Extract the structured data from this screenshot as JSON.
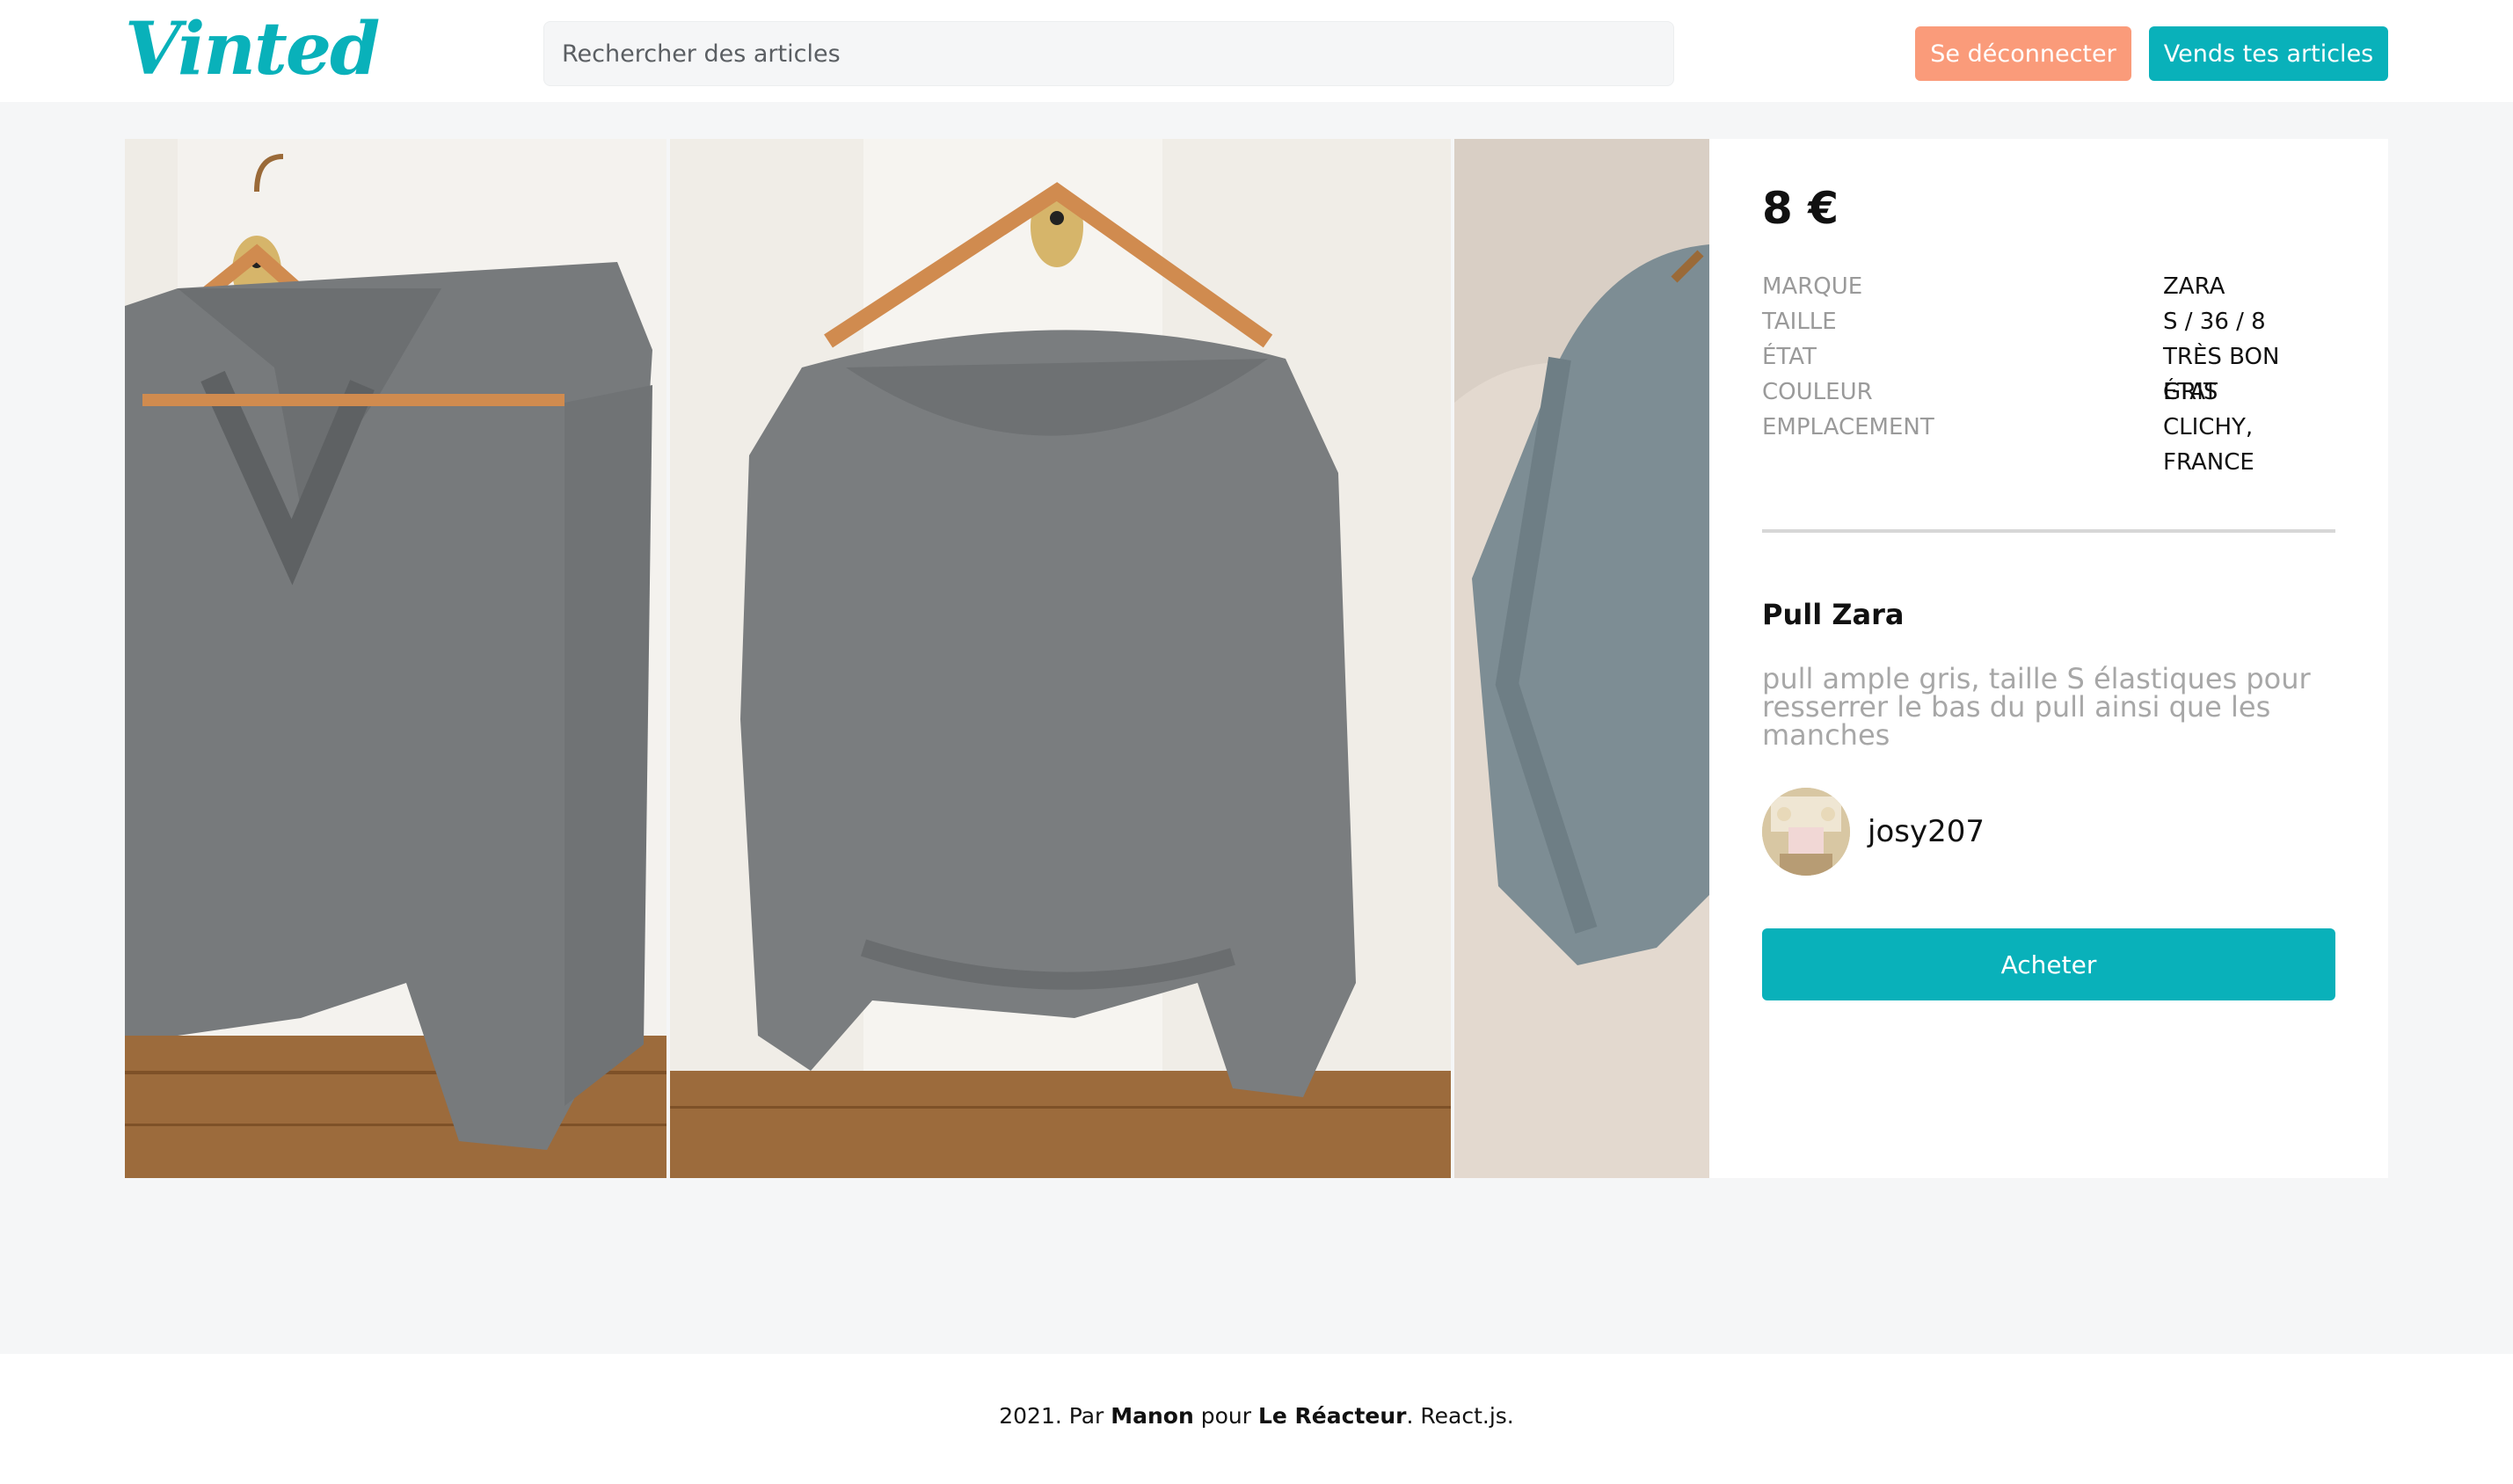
{
  "header": {
    "logo": "Vinted",
    "search_placeholder": "Rechercher des articles",
    "logout_label": "Se déconnecter",
    "sell_label": "Vends tes articles"
  },
  "offer": {
    "price": "8 €",
    "details": [
      {
        "key": "MARQUE",
        "value": "ZARA"
      },
      {
        "key": "TAILLE",
        "value": "S / 36 / 8"
      },
      {
        "key": "ÉTAT",
        "value": "TRÈS BON ÉTAT"
      },
      {
        "key": "COULEUR",
        "value": "GRIS"
      },
      {
        "key": "EMPLACEMENT",
        "value": "CLICHY, FRANCE"
      }
    ],
    "title": "Pull Zara",
    "description": "pull ample gris, taille S élastiques pour resserrer le bas du pull ainsi que les manches",
    "seller": "josy207",
    "buy_label": "Acheter"
  },
  "footer": {
    "year": "2021. Par ",
    "author": "Manon",
    "middle": " pour ",
    "school": "Le Réacteur",
    "tail": ". React.js."
  },
  "colors": {
    "accent": "#09b1ba",
    "logout": "#fa9b7a",
    "background": "#f5f6f7"
  }
}
